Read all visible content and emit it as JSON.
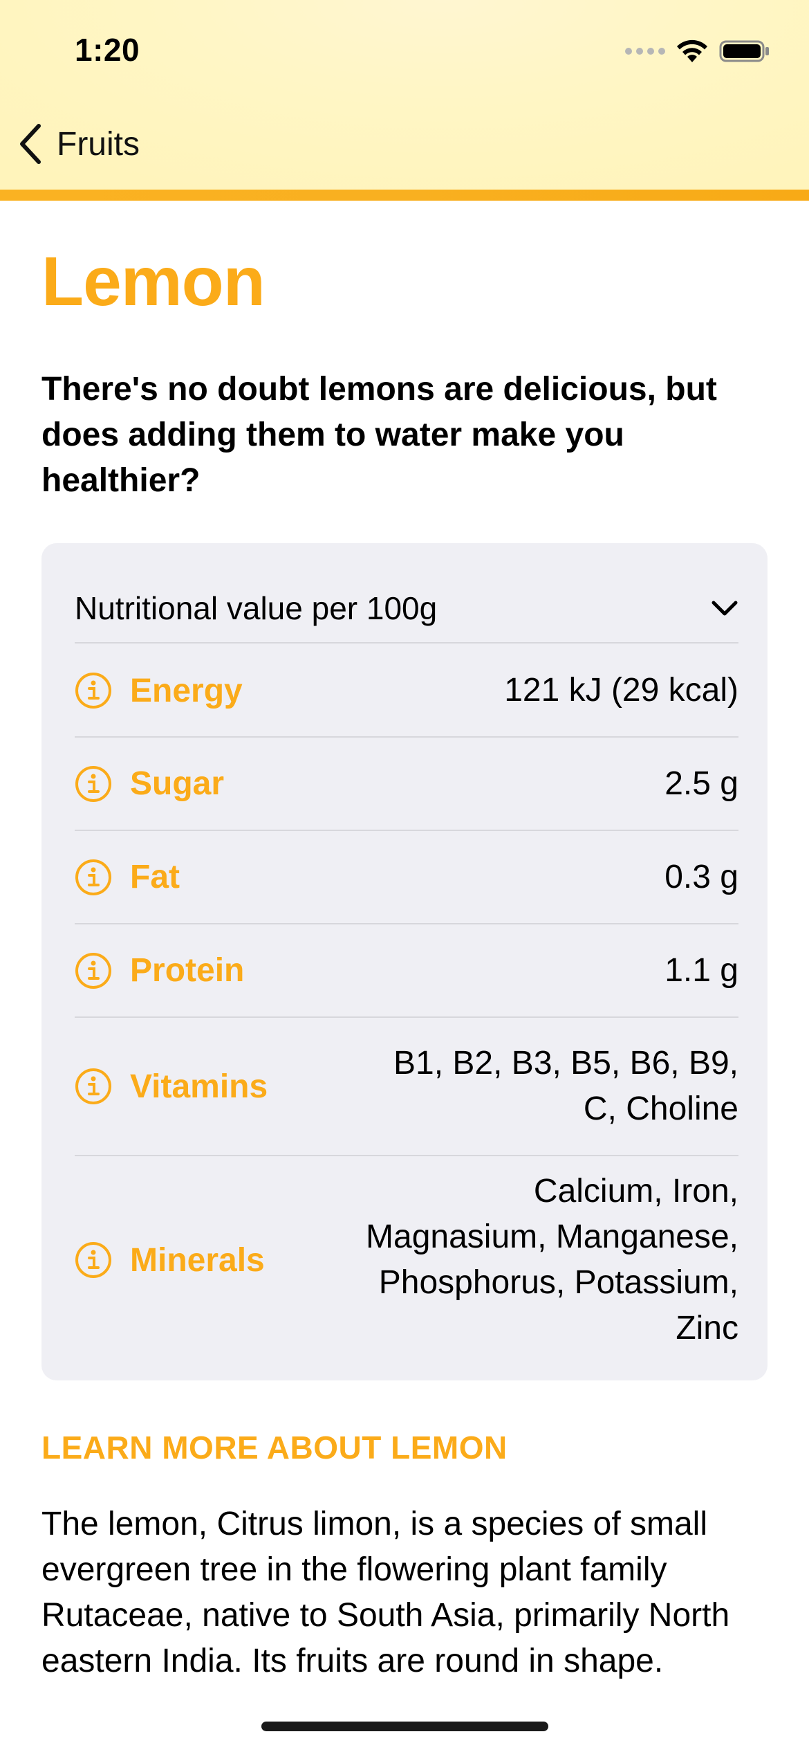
{
  "status_bar": {
    "time": "1:20",
    "icons": [
      "cellular-dots-icon",
      "wifi-icon",
      "battery-icon"
    ]
  },
  "nav": {
    "back_label": "Fruits",
    "back_icon": "chevron-left-icon"
  },
  "fruit": {
    "title": "Lemon",
    "subtitle": "There's no doubt lemons are delicious, but does adding them to water make you healthier?"
  },
  "nutrition": {
    "header": "Nutritional value per 100g",
    "items": [
      {
        "name": "Energy",
        "value": "121 kJ (29 kcal)"
      },
      {
        "name": "Sugar",
        "value": "2.5 g"
      },
      {
        "name": "Fat",
        "value": "0.3 g"
      },
      {
        "name": "Protein",
        "value": "1.1 g"
      },
      {
        "name": "Vitamins",
        "value_lines": [
          "B1, B2, B3, B5, B6, B9,",
          "C, Choline"
        ]
      },
      {
        "name": "Minerals",
        "value_lines": [
          "Calcium, Iron,",
          "Magnasium, Manganese,",
          "Phosphorus, Potassium,",
          "Zinc"
        ]
      }
    ]
  },
  "learn_more": {
    "heading": "LEARN MORE ABOUT LEMON",
    "description": "The lemon, Citrus limon, is a species of small evergreen tree in the flowering plant family Rutaceae, native to South Asia, primarily North eastern India. Its fruits are round in shape."
  },
  "colors": {
    "accent": "#fbab19",
    "header_bg": "#fff6c6",
    "card_bg": "#efeff4"
  }
}
